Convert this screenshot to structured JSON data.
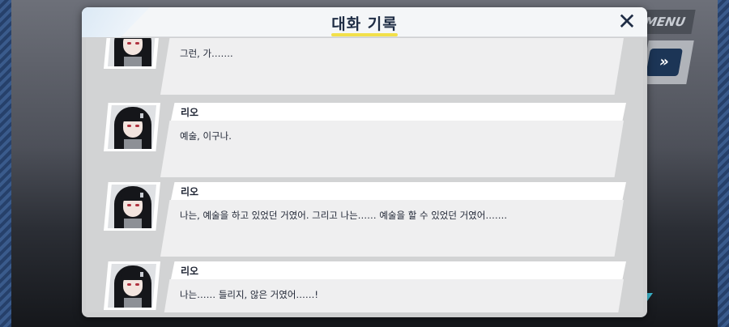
{
  "background": {
    "menu_label": "MENU",
    "skip_icon": "double-chevron-right"
  },
  "dialog": {
    "title": "대화 기록",
    "close_icon": "close-x",
    "entries": [
      {
        "speaker": "",
        "line": "그런, 가……."
      },
      {
        "speaker": "리오",
        "line": "예술, 이구나."
      },
      {
        "speaker": "리오",
        "line": "나는, 예술을 하고 있었던 거였어. 그리고 나는…… 예술을 할 수 있었던 거였어……."
      },
      {
        "speaker": "리오",
        "line": "나는…… 들리지, 않은 거였어……!"
      }
    ]
  },
  "colors": {
    "title_underline": "#f2e04a",
    "title_text": "#1f2d45",
    "panel_bg": "#d2d3d4",
    "stripe_blue": "#3a5b8c"
  }
}
